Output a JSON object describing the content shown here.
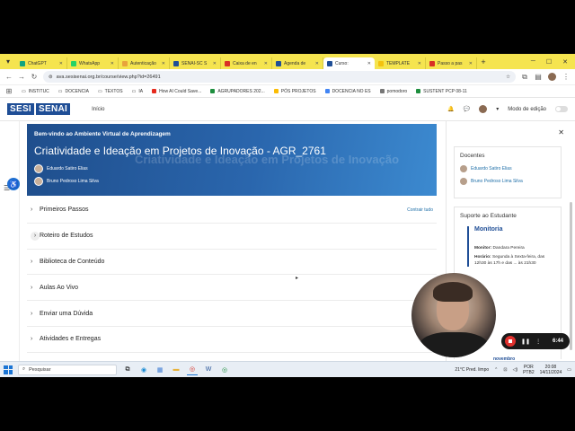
{
  "browser": {
    "tabs": [
      {
        "label": "ChatGPT",
        "color": "#10a37f"
      },
      {
        "label": "WhatsApp",
        "color": "#25d366"
      },
      {
        "label": "Autenticação",
        "color": "#e8a33c"
      },
      {
        "label": "SENAI-SC S",
        "color": "#1f4e96"
      },
      {
        "label": "Caixa de en",
        "color": "#d93025"
      },
      {
        "label": "Agenda de",
        "color": "#1f4e96"
      },
      {
        "label": "Curso:",
        "color": "#1f4e96",
        "active": true
      },
      {
        "label": "TEMPLATE",
        "color": "#f4c20d"
      },
      {
        "label": "Passo a pas",
        "color": "#d93025"
      }
    ],
    "url": "ava.sesisenai.org.br/course/view.php?id=26491",
    "bookmarks": [
      {
        "label": "INSTITUC"
      },
      {
        "label": "DOCENCIA"
      },
      {
        "label": "TEXTOS"
      },
      {
        "label": "IA"
      },
      {
        "label": "How AI Could Save..."
      },
      {
        "label": "AGRUPADORES 202..."
      },
      {
        "label": "PÓS PROJETOS"
      },
      {
        "label": "DOCENCIA NO ES"
      },
      {
        "label": "pomodoro"
      },
      {
        "label": "SUSTENT PCP 08-11"
      }
    ]
  },
  "site": {
    "logo": [
      "SESI",
      "SENAI"
    ],
    "nav_home": "Início",
    "edit_mode": "Modo de edição"
  },
  "course": {
    "welcome": "Bem-vindo ao Ambiente Virtual de Aprendizagem",
    "title": "Criatividade e Ideação em Projetos de Inovação - AGR_2761",
    "ghost_title": "Criatividade e Ideação em Projetos de Inovação",
    "tutors": [
      "Eduardo Satiro Elias",
      "Bruno Pedroso Lima Silva"
    ],
    "collapse_all": "Contrair tudo",
    "sections": [
      "Primeiros Passos",
      "Roteiro de Estudos",
      "Biblioteca de Conteúdo",
      "Aulas Ao Vivo",
      "Enviar uma Dúvida",
      "Atividades e Entregas"
    ]
  },
  "drawer": {
    "docentes_title": "Docentes",
    "docentes": [
      "Eduardo Satiro Elias",
      "Bruno Pedroso Lima Silva"
    ],
    "suporte_title": "Suporte ao Estudante",
    "monitoria_title": "Monitoria",
    "monitor_label": "Monitor:",
    "monitor_name": "Dandara Pereira",
    "horario_label": "Horário:",
    "horario_text": "Segunda à Sexta-feira, das 12h30 às 17h e das ... às 21h30",
    "calendar_month": "novembro"
  },
  "recorder": {
    "time": "6:44"
  },
  "taskbar": {
    "search_placeholder": "Pesquisar",
    "weather": "21°C  Pred. limpo",
    "lang": "POR",
    "layout": "PTB2",
    "time": "20:08",
    "date": "14/11/2024"
  }
}
